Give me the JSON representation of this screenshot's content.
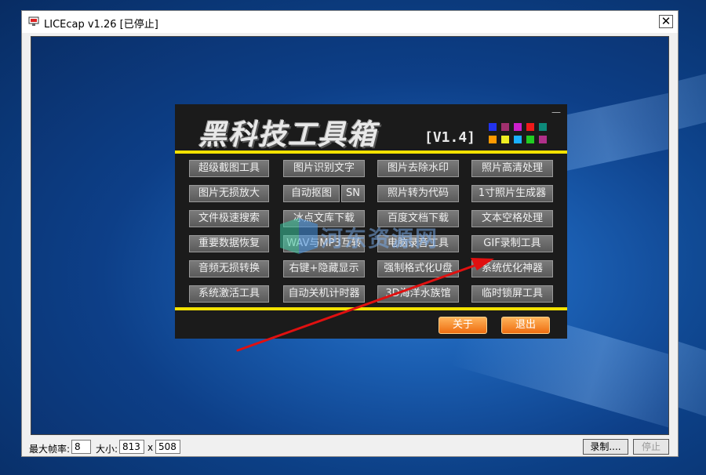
{
  "window": {
    "title": "LICEcap v1.26 [已停止]",
    "close_glyph": "✕"
  },
  "statusbar": {
    "fps_label": "最大帧率:",
    "fps_value": "8",
    "size_label": "大小:",
    "width_value": "813",
    "x_label": "x",
    "height_value": "508",
    "record_label": "录制....",
    "stop_label": "停止"
  },
  "toolbox": {
    "title": "黑科技工具箱",
    "version": "[V1.4]",
    "minimize_glyph": "—",
    "swatch_colors": [
      "#2233ee",
      "#a0306e",
      "#cc1fcc",
      "#ee1a1a",
      "#0d8a7a",
      "#ff9a00",
      "#eeee22",
      "#1ab0ff",
      "#22cc22",
      "#b0308a"
    ],
    "buttons": [
      [
        "超级截图工具",
        "图片识别文字",
        "图片去除水印",
        "照片高清处理"
      ],
      [
        "图片无损放大",
        "自动抠图",
        "SN",
        "照片转为代码",
        "1寸照片生成器"
      ],
      [
        "文件极速搜索",
        "冰点文库下载",
        "百度文档下载",
        "文本空格处理"
      ],
      [
        "重要数据恢复",
        "WAV与MP3互转",
        "电脑录音工具",
        "GIF录制工具"
      ],
      [
        "音频无损转换",
        "右键+隐藏显示",
        "强制格式化U盘",
        "系统优化神器"
      ],
      [
        "系统激活工具",
        "自动关机计时器",
        "3D海洋水族馆",
        "临时锁屏工具"
      ]
    ],
    "about_label": "关于",
    "exit_label": "退出"
  },
  "watermark": {
    "text": "河东资源网"
  },
  "colors": {
    "accent_yellow": "#f4e200",
    "arrow_red": "#e01010",
    "orange_button": "#ee6d10"
  }
}
